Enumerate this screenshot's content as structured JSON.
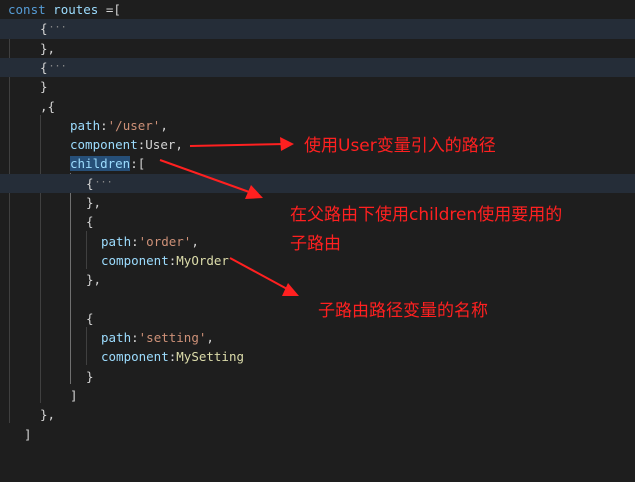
{
  "colors": {
    "background": "#1e1e1e",
    "keyword": "#569cd6",
    "variable": "#9cdcfe",
    "text": "#d4d4d4",
    "string": "#ce9178",
    "component": "#dcdcaa",
    "folded_ellipsis": "#8a8a8a",
    "annotation": "#ff2020",
    "selection": "#264f78"
  },
  "code": {
    "const_keyword": "const",
    "routes_var": "routes",
    "assign_open": " =[",
    "brace_open": "{",
    "ellipsis": "···",
    "brace_close_comma": "},",
    "brace_close": "}",
    "comma_brace_open": ",{",
    "path_key": "path",
    "path_user_value": "'/user'",
    "component_key": "component",
    "component_user": "User",
    "children_key": "children",
    "colon": ":",
    "comma": ",",
    "bracket_open": "[",
    "path_order_value": "'order'",
    "component_myorder": "MyOrder",
    "path_setting_value": "'setting'",
    "component_mysetting": "MySetting",
    "bracket_close": "]"
  },
  "annotations": {
    "user_component_note": "使用User变量引入的路径",
    "children_note_line1": "在父路由下使用children使用要用的",
    "children_note_line2": "子路由",
    "child_component_note": "子路由路径变量的名称"
  }
}
